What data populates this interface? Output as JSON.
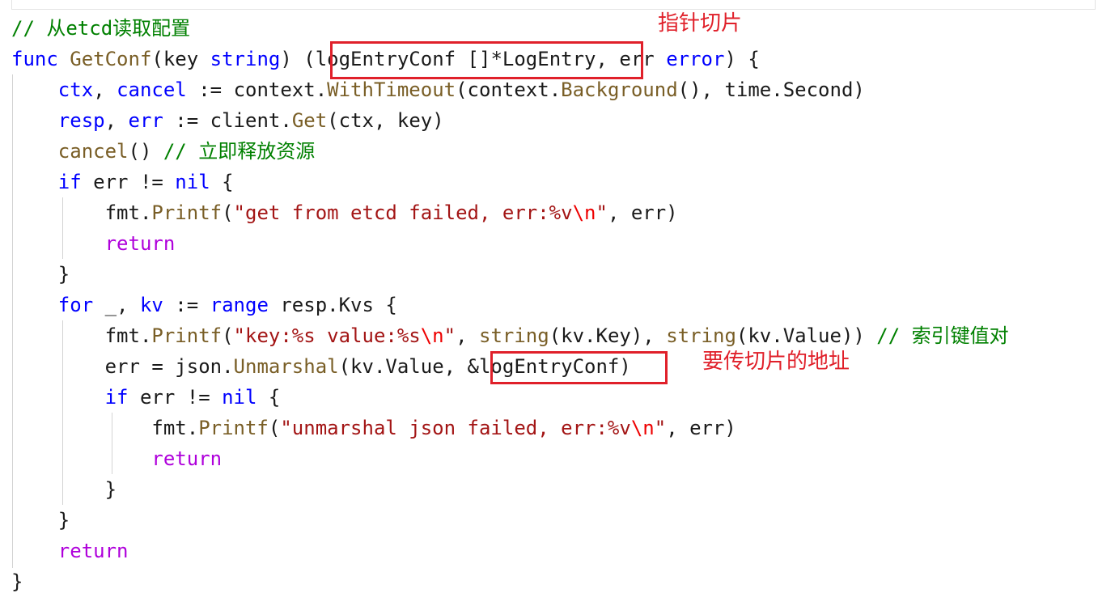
{
  "editor": {
    "lines": [
      [
        {
          "t": "// 从etcd读取配置",
          "c": "cm"
        }
      ],
      [
        {
          "t": "func",
          "c": "kw"
        },
        {
          "t": " ",
          "c": "tx"
        },
        {
          "t": "GetConf",
          "c": "fn"
        },
        {
          "t": "(key ",
          "c": "tx"
        },
        {
          "t": "string",
          "c": "kw"
        },
        {
          "t": ") (logEntryConf []*LogEntry, err ",
          "c": "tx"
        },
        {
          "t": "error",
          "c": "kw"
        },
        {
          "t": ") {",
          "c": "tx"
        }
      ],
      [
        {
          "t": "    ",
          "c": "tx"
        },
        {
          "t": "ctx",
          "c": "kw"
        },
        {
          "t": ", ",
          "c": "tx"
        },
        {
          "t": "cancel",
          "c": "kw"
        },
        {
          "t": " := context.",
          "c": "tx"
        },
        {
          "t": "WithTimeout",
          "c": "fn"
        },
        {
          "t": "(context.",
          "c": "tx"
        },
        {
          "t": "Background",
          "c": "fn"
        },
        {
          "t": "(), time.Second)",
          "c": "tx"
        }
      ],
      [
        {
          "t": "    ",
          "c": "tx"
        },
        {
          "t": "resp",
          "c": "kw"
        },
        {
          "t": ", ",
          "c": "tx"
        },
        {
          "t": "err",
          "c": "kw"
        },
        {
          "t": " := client.",
          "c": "tx"
        },
        {
          "t": "Get",
          "c": "fn"
        },
        {
          "t": "(ctx, key)",
          "c": "tx"
        }
      ],
      [
        {
          "t": "    ",
          "c": "tx"
        },
        {
          "t": "cancel",
          "c": "fn"
        },
        {
          "t": "() ",
          "c": "tx"
        },
        {
          "t": "// 立即释放资源",
          "c": "cm"
        }
      ],
      [
        {
          "t": "    ",
          "c": "tx"
        },
        {
          "t": "if",
          "c": "kw"
        },
        {
          "t": " err != ",
          "c": "tx"
        },
        {
          "t": "nil",
          "c": "kw"
        },
        {
          "t": " {",
          "c": "tx"
        }
      ],
      [
        {
          "t": "        fmt.",
          "c": "tx"
        },
        {
          "t": "Printf",
          "c": "fn"
        },
        {
          "t": "(",
          "c": "tx"
        },
        {
          "t": "\"get from etcd failed, err:%v",
          "c": "str"
        },
        {
          "t": "\\n",
          "c": "esc"
        },
        {
          "t": "\"",
          "c": "str"
        },
        {
          "t": ", err)",
          "c": "tx"
        }
      ],
      [
        {
          "t": "        ",
          "c": "tx"
        },
        {
          "t": "return",
          "c": "ctl"
        }
      ],
      [
        {
          "t": "    }",
          "c": "tx"
        }
      ],
      [
        {
          "t": "    ",
          "c": "tx"
        },
        {
          "t": "for",
          "c": "kw"
        },
        {
          "t": " _, ",
          "c": "tx"
        },
        {
          "t": "kv",
          "c": "kw"
        },
        {
          "t": " := ",
          "c": "tx"
        },
        {
          "t": "range",
          "c": "kw"
        },
        {
          "t": " resp.Kvs {",
          "c": "tx"
        }
      ],
      [
        {
          "t": "        fmt.",
          "c": "tx"
        },
        {
          "t": "Printf",
          "c": "fn"
        },
        {
          "t": "(",
          "c": "tx"
        },
        {
          "t": "\"key:%s value:%s",
          "c": "str"
        },
        {
          "t": "\\n",
          "c": "esc"
        },
        {
          "t": "\"",
          "c": "str"
        },
        {
          "t": ", ",
          "c": "tx"
        },
        {
          "t": "string",
          "c": "fn"
        },
        {
          "t": "(kv.Key), ",
          "c": "tx"
        },
        {
          "t": "string",
          "c": "fn"
        },
        {
          "t": "(kv.Value)) ",
          "c": "tx"
        },
        {
          "t": "// 索引键值对",
          "c": "cm"
        }
      ],
      [
        {
          "t": "        err = json.",
          "c": "tx"
        },
        {
          "t": "Unmarshal",
          "c": "fn"
        },
        {
          "t": "(kv.Value, &logEntryConf)",
          "c": "tx"
        }
      ],
      [
        {
          "t": "        ",
          "c": "tx"
        },
        {
          "t": "if",
          "c": "kw"
        },
        {
          "t": " err != ",
          "c": "tx"
        },
        {
          "t": "nil",
          "c": "kw"
        },
        {
          "t": " {",
          "c": "tx"
        }
      ],
      [
        {
          "t": "            fmt.",
          "c": "tx"
        },
        {
          "t": "Printf",
          "c": "fn"
        },
        {
          "t": "(",
          "c": "tx"
        },
        {
          "t": "\"unmarshal json failed, err:%v",
          "c": "str"
        },
        {
          "t": "\\n",
          "c": "esc"
        },
        {
          "t": "\"",
          "c": "str"
        },
        {
          "t": ", err)",
          "c": "tx"
        }
      ],
      [
        {
          "t": "            ",
          "c": "tx"
        },
        {
          "t": "return",
          "c": "ctl"
        }
      ],
      [
        {
          "t": "        }",
          "c": "tx"
        }
      ],
      [
        {
          "t": "    }",
          "c": "tx"
        }
      ],
      [
        {
          "t": "    ",
          "c": "tx"
        },
        {
          "t": "return",
          "c": "ctl"
        }
      ],
      [
        {
          "t": "}",
          "c": "tx"
        }
      ]
    ]
  },
  "annotations": {
    "pointer_slice": "指针切片",
    "pass_slice_address": "要传切片的地址"
  },
  "colors": {
    "keyword": "#0000ff",
    "control": "#af00db",
    "function": "#795e26",
    "string": "#a31515",
    "escape": "#ee0000",
    "comment": "#008000",
    "highlight": "#e0202a"
  }
}
